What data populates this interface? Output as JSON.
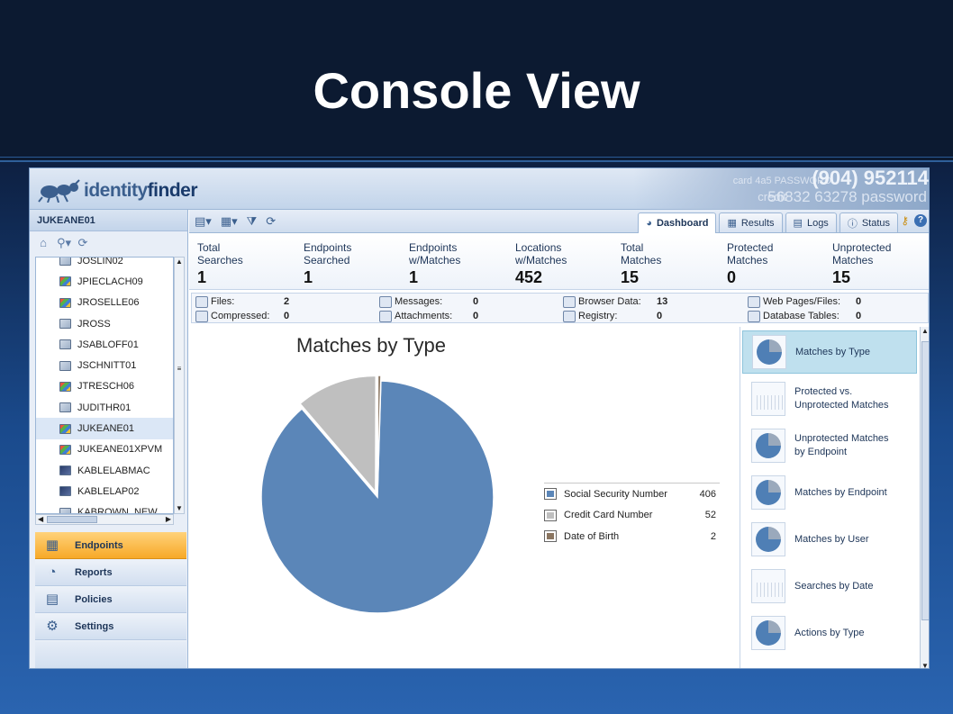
{
  "slide": {
    "title": "Console View"
  },
  "app": {
    "logo": {
      "part1": "identity",
      "part2": "finder"
    },
    "banner_text": {
      "phone": "(904) 952114",
      "word1": "credit",
      "word2": "56832 63278 password",
      "word3": "card 4a5 PASSWORD"
    }
  },
  "left_panel": {
    "title": "JUKEANE01",
    "tree_items": [
      {
        "label": "JOSLIN02",
        "icon": "computer-icon"
      },
      {
        "label": "JPIECLACH09",
        "icon": "windows-computer-icon"
      },
      {
        "label": "JROSELLE06",
        "icon": "windows-computer-icon"
      },
      {
        "label": "JROSS",
        "icon": "computer-icon"
      },
      {
        "label": "JSABLOFF01",
        "icon": "computer-icon"
      },
      {
        "label": "JSCHNITT01",
        "icon": "computer-icon"
      },
      {
        "label": "JTRESCH06",
        "icon": "windows-computer-icon"
      },
      {
        "label": "JUDITHR01",
        "icon": "computer-icon"
      },
      {
        "label": "JUKEANE01",
        "icon": "windows-computer-icon",
        "selected": true
      },
      {
        "label": "JUKEANE01XPVM",
        "icon": "windows-computer-icon"
      },
      {
        "label": "KABLELABMAC",
        "icon": "dark-computer-icon"
      },
      {
        "label": "KABLELAP02",
        "icon": "dark-computer-icon"
      },
      {
        "label": "KABROWN_NEW",
        "icon": "computer-icon"
      }
    ],
    "nav": [
      {
        "label": "Endpoints",
        "icon": "endpoints-icon",
        "active": true
      },
      {
        "label": "Reports",
        "icon": "reports-icon"
      },
      {
        "label": "Policies",
        "icon": "policies-icon"
      },
      {
        "label": "Settings",
        "icon": "settings-gear-icon"
      }
    ]
  },
  "tabs": [
    {
      "label": "Dashboard",
      "icon": "dashboard-icon",
      "active": true
    },
    {
      "label": "Results",
      "icon": "results-icon"
    },
    {
      "label": "Logs",
      "icon": "logs-icon"
    },
    {
      "label": "Status",
      "icon": "status-icon"
    }
  ],
  "stats": [
    {
      "label": "Total\nSearches",
      "value": "1"
    },
    {
      "label": "Endpoints\nSearched",
      "value": "1"
    },
    {
      "label": "Endpoints\nw/Matches",
      "value": "1"
    },
    {
      "label": "Locations\nw/Matches",
      "value": "452"
    },
    {
      "label": "Total\nMatches",
      "value": "15"
    },
    {
      "label": "Protected\nMatches",
      "value": "0"
    },
    {
      "label": "Unprotected\nMatches",
      "value": "15"
    }
  ],
  "counts": {
    "files": {
      "label": "Files:",
      "value": "2"
    },
    "compressed": {
      "label": "Compressed:",
      "value": "0"
    },
    "messages": {
      "label": "Messages:",
      "value": "0"
    },
    "attachments": {
      "label": "Attachments:",
      "value": "0"
    },
    "browser": {
      "label": "Browser Data:",
      "value": "13"
    },
    "registry": {
      "label": "Registry:",
      "value": "0"
    },
    "web": {
      "label": "Web Pages/Files:",
      "value": "0"
    },
    "db": {
      "label": "Database Tables:",
      "value": "0"
    }
  },
  "chart_data": {
    "type": "pie",
    "title": "Matches by Type",
    "categories": [
      "Social Security Number",
      "Credit Card Number",
      "Date of Birth"
    ],
    "values": [
      406,
      52,
      2
    ],
    "colors": [
      "#5b86b8",
      "#bfbfbf",
      "#8a7560"
    ],
    "legend": "right"
  },
  "chart_list": [
    {
      "label": "Matches by Type",
      "selected": true
    },
    {
      "label": "Protected vs.\nUnprotected Matches"
    },
    {
      "label": "Unprotected Matches\nby Endpoint"
    },
    {
      "label": "Matches by Endpoint"
    },
    {
      "label": "Matches by User"
    },
    {
      "label": "Searches by Date"
    },
    {
      "label": "Actions by Type"
    }
  ]
}
